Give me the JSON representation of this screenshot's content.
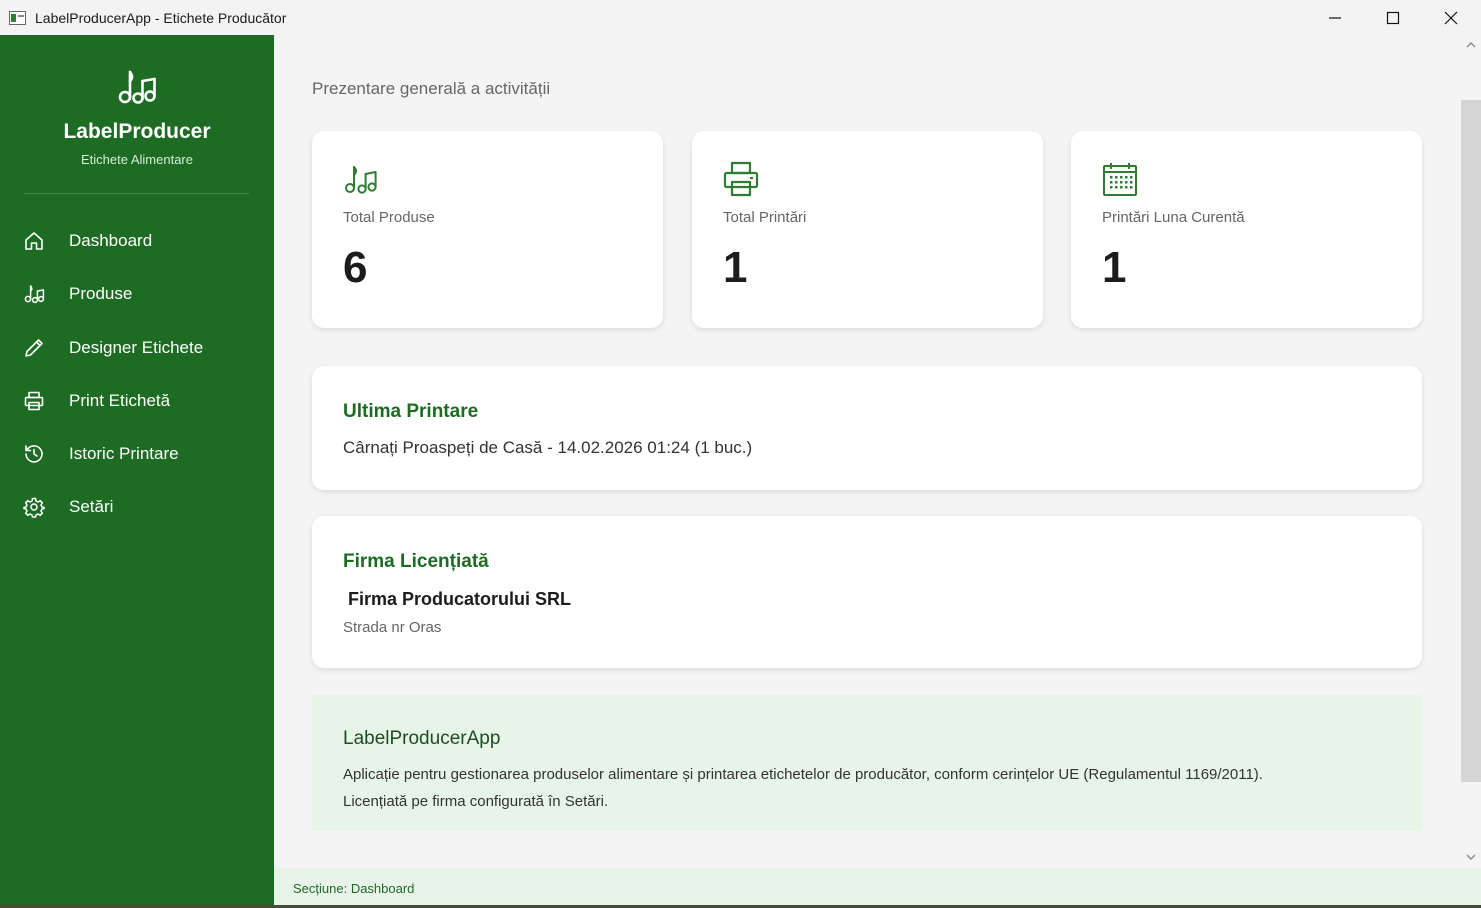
{
  "window": {
    "title": "LabelProducerApp - Etichete Producător",
    "app_icon": "app-window-icon",
    "controls": [
      "minimize-icon",
      "maximize-icon",
      "close-icon"
    ]
  },
  "sidebar": {
    "brand_icon": "music-notes-icon",
    "brand_name": "LabelProducer",
    "brand_subtitle": "Etichete Alimentare",
    "items": [
      {
        "label": "Dashboard",
        "icon": "home-icon"
      },
      {
        "label": "Produse",
        "icon": "music-notes-icon"
      },
      {
        "label": "Designer Etichete",
        "icon": "pencil-icon"
      },
      {
        "label": "Print Etichetă",
        "icon": "printer-icon"
      },
      {
        "label": "Istoric Printare",
        "icon": "history-icon"
      },
      {
        "label": "Setări",
        "icon": "gear-icon"
      }
    ]
  },
  "main": {
    "subtitle": "Prezentare generală a activității",
    "stats": [
      {
        "label": "Total Produse",
        "value": "6",
        "icon": "music-notes-icon"
      },
      {
        "label": "Total Printări",
        "value": "1",
        "icon": "printer-icon"
      },
      {
        "label": "Printări Luna Curentă",
        "value": "1",
        "icon": "calendar-icon"
      }
    ],
    "last_print": {
      "title": "Ultima Printare",
      "text": "Cârnați Proaspeți de Casă - 14.02.2026 01:24 (1 buc.)"
    },
    "licensed_firm": {
      "title": "Firma Licențiată",
      "name": "Firma Producatorului SRL",
      "address": "Strada nr Oras"
    },
    "about": {
      "title": "LabelProducerApp",
      "line1": "Aplicație pentru gestionarea produselor alimentare și printarea etichetelor de producător, conform cerințelor UE (Regulamentul 1169/2011).",
      "line2": "Licențiată pe firma configurată în Setări."
    }
  },
  "status_bar": {
    "text": "Secțiune: Dashboard"
  },
  "colors": {
    "sidebar": "#1e6b24",
    "accent": "#1e6b24",
    "about_bg": "#e7f4e8",
    "status_bg": "#e8f4e9"
  }
}
